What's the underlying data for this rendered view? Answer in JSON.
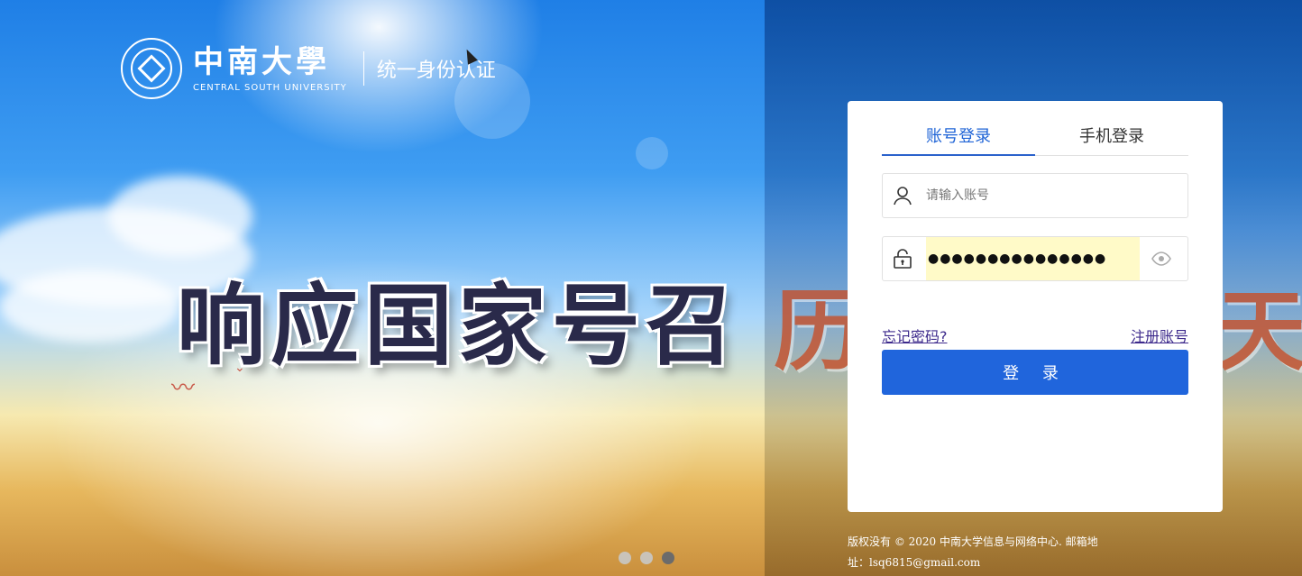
{
  "brand": {
    "name_cn": "中南大學",
    "name_en": "CENTRAL SOUTH UNIVERSITY",
    "subtitle": "统一身份认证"
  },
  "banner": {
    "slogan_left": "响应国家号召",
    "slogan_right_fragment": "历",
    "slogan_right_fragment_2": "天",
    "slides": 3,
    "active_slide": 3
  },
  "login": {
    "tabs": [
      {
        "label": "账号登录",
        "active": true
      },
      {
        "label": "手机登录",
        "active": false
      }
    ],
    "username": {
      "placeholder": "请输入账号",
      "value": ""
    },
    "password": {
      "masked": "●●●●●●●●●●●●●●●"
    },
    "forgot_label": "忘记密码?",
    "register_label": "注册账号",
    "submit_label": "登 录"
  },
  "footer": {
    "line1": "版权没有 © 2020 中南大学信息与网络中心. 邮箱地",
    "line2": "址：lsq6815@gmail.com"
  },
  "colors": {
    "primary": "#2065dc",
    "tab_active": "#1e63d6",
    "link": "#3d2a8c",
    "autofill": "#fffac8"
  }
}
